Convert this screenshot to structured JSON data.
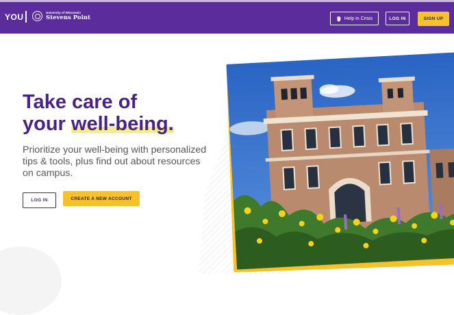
{
  "header": {
    "brand_you": "YOU",
    "university_small": "University of Wisconsin",
    "university_name": "Stevens Point",
    "crisis_label": "Help in Crisis",
    "crisis_icon": "hand-icon",
    "login_label": "LOG IN",
    "signup_label": "SIGN UP"
  },
  "hero": {
    "title_line1": "Take care of",
    "title_line2_prefix": "your ",
    "title_line2_highlight": "well-being.",
    "description": "Prioritize your well-being with personalized tips & tools, plus find out about resources on campus.",
    "login_label": "LOG IN",
    "create_label": "CREATE A NEW ACCOUNT"
  },
  "colors": {
    "brand_purple": "#5b2d9c",
    "heading_purple": "#4a2285",
    "accent_yellow": "#f6c228",
    "highlight": "#f3ec8e"
  }
}
